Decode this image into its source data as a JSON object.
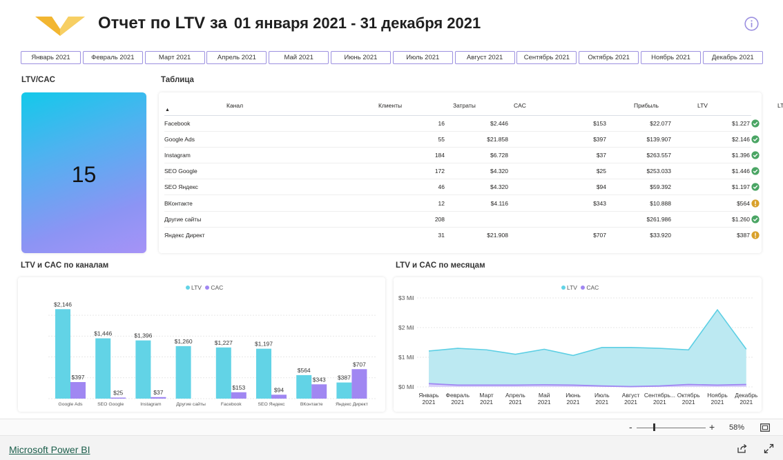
{
  "header": {
    "title": "Отчет по LTV за",
    "date_range": "01 января 2021 - 31 декабря 2021",
    "logo": "chevron-logo",
    "info_icon": "info-icon"
  },
  "months": [
    "Январь 2021",
    "Февраль 2021",
    "Март 2021",
    "Апрель 2021",
    "Май 2021",
    "Июнь 2021",
    "Июль 2021",
    "Август 2021",
    "Сентябрь 2021",
    "Октябрь 2021",
    "Ноябрь 2021",
    "Декабрь 2021"
  ],
  "kpi": {
    "label": "LTV/CAC",
    "value": "15"
  },
  "table": {
    "label": "Таблица",
    "columns": [
      "Канал",
      "Клиенты",
      "Затраты",
      "CAC",
      "Прибыль",
      "LTV",
      "LTV/CAC"
    ],
    "rows": [
      {
        "channel": "Facebook",
        "clients": "16",
        "costs": "$2.446",
        "cac": "$153",
        "profit": "$22.077",
        "ltv": "$1.227",
        "status": "ok"
      },
      {
        "channel": "Google Ads",
        "clients": "55",
        "costs": "$21.858",
        "cac": "$397",
        "profit": "$139.907",
        "ltv": "$2.146",
        "status": "ok"
      },
      {
        "channel": "Instagram",
        "clients": "184",
        "costs": "$6.728",
        "cac": "$37",
        "profit": "$263.557",
        "ltv": "$1.396",
        "status": "ok"
      },
      {
        "channel": "SEO Google",
        "clients": "172",
        "costs": "$4.320",
        "cac": "$25",
        "profit": "$253.033",
        "ltv": "$1.446",
        "status": "ok"
      },
      {
        "channel": "SEO Яндекс",
        "clients": "46",
        "costs": "$4.320",
        "cac": "$94",
        "profit": "$59.392",
        "ltv": "$1.197",
        "status": "ok"
      },
      {
        "channel": "ВКонтакте",
        "clients": "12",
        "costs": "$4.116",
        "cac": "$343",
        "profit": "$10.888",
        "ltv": "$564",
        "status": "warn"
      },
      {
        "channel": "Другие сайты",
        "clients": "208",
        "costs": "",
        "cac": "",
        "profit": "$261.986",
        "ltv": "$1.260",
        "status": "ok"
      },
      {
        "channel": "Яндекс Директ",
        "clients": "31",
        "costs": "$21.908",
        "cac": "$707",
        "profit": "$33.920",
        "ltv": "$387",
        "status": "warn"
      }
    ],
    "status_colors": {
      "ok": "#4aa564",
      "warn": "#d9a12b"
    }
  },
  "colors": {
    "ltv": "#62d3e6",
    "cac": "#a087f2",
    "ltv_area": "#bce9f2",
    "ltv_line": "#5ccfe4"
  },
  "channels_chart_label": "LTV и CAC по каналам",
  "months_chart_label": "LTV и CAC по месяцам",
  "chart_data": [
    {
      "type": "bar",
      "legend": [
        "LTV",
        "CAC"
      ],
      "legend_position": "top-center",
      "categories": [
        "Google Ads",
        "SEO Google",
        "Instagram",
        "Другие сайты",
        "Facebook",
        "SEO Яндекс",
        "ВКонтакте",
        "Яндекс Директ"
      ],
      "series": [
        {
          "name": "LTV",
          "values": [
            2146,
            1446,
            1396,
            1260,
            1227,
            1197,
            564,
            387
          ],
          "labels": [
            "$2,146",
            "$1,446",
            "$1,396",
            "$1,260",
            "$1,227",
            "$1,197",
            "$564",
            "$387"
          ]
        },
        {
          "name": "CAC",
          "values": [
            397,
            25,
            37,
            null,
            153,
            94,
            343,
            707
          ],
          "labels": [
            "$397",
            "$25",
            "$37",
            "",
            "$153",
            "$94",
            "$343",
            "$707"
          ]
        }
      ],
      "ylim": [
        0,
        2250
      ],
      "grid": true
    },
    {
      "type": "area",
      "legend": [
        "LTV",
        "CAC"
      ],
      "legend_position": "top-center",
      "x": [
        "Январь|2021",
        "Февраль|2021",
        "Март|2021",
        "Апрель|2021",
        "Май|2021",
        "Июнь|2021",
        "Июль|2021",
        "Август|2021",
        "Сентябрь...|2021",
        "Октябрь|2021",
        "Ноябрь|2021",
        "Декабрь|2021"
      ],
      "series": [
        {
          "name": "LTV",
          "values": [
            1.21,
            1.3,
            1.25,
            1.1,
            1.27,
            1.06,
            1.33,
            1.33,
            1.3,
            1.25,
            2.6,
            1.27
          ]
        },
        {
          "name": "CAC",
          "values": [
            0.11,
            0.06,
            0.06,
            0.06,
            0.07,
            0.06,
            0.03,
            0.01,
            0.03,
            0.08,
            0.06,
            0.08
          ]
        }
      ],
      "yticks": [
        0,
        1,
        2,
        3
      ],
      "ytick_labels": [
        "$0 Mil",
        "$1 Mil",
        "$2 Mil",
        "$3 Mil"
      ],
      "ylim": [
        0,
        3
      ],
      "grid": true
    }
  ],
  "zoom": {
    "minus": "-",
    "plus": "+",
    "level": "58%",
    "level_value": 58
  },
  "footer": {
    "link": "Microsoft Power BI"
  }
}
